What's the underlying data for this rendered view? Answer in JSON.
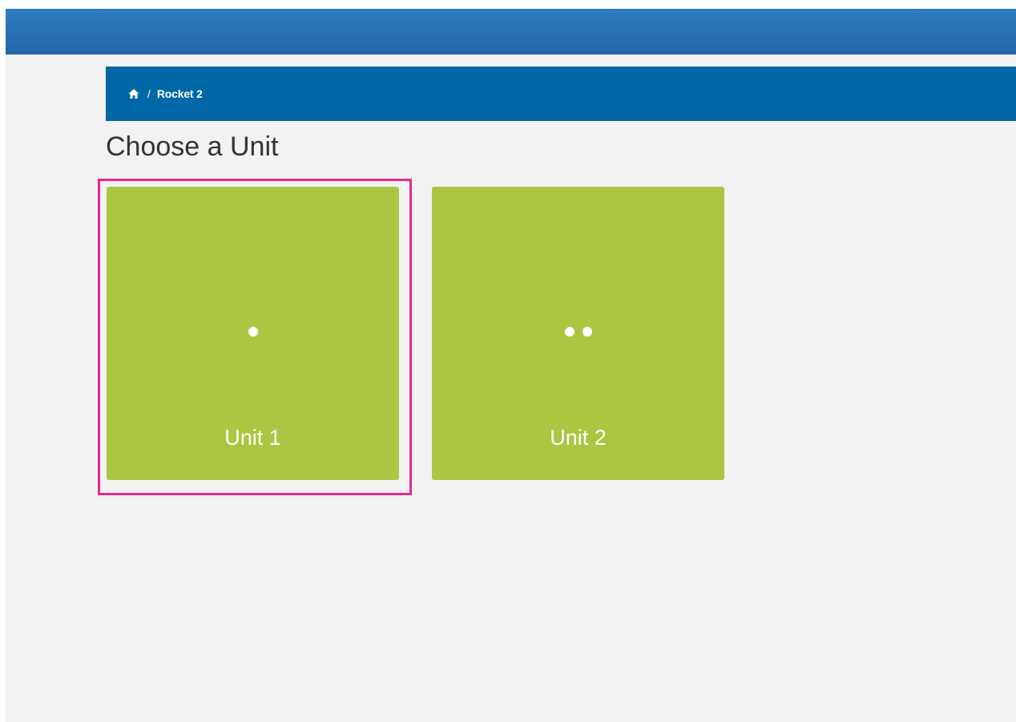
{
  "breadcrumb": {
    "home_icon": "home-icon",
    "separator": "/",
    "current": "Rocket 2"
  },
  "page": {
    "title": "Choose a Unit"
  },
  "units": [
    {
      "label": "Unit 1",
      "dots": 1,
      "selected": true
    },
    {
      "label": "Unit 2",
      "dots": 2,
      "selected": false
    }
  ],
  "colors": {
    "top_bar": "#2a71b4",
    "breadcrumb_bg": "#0068a7",
    "card_bg": "#abc642",
    "highlight": "#e8288f",
    "page_bg": "#f2f2f2"
  }
}
